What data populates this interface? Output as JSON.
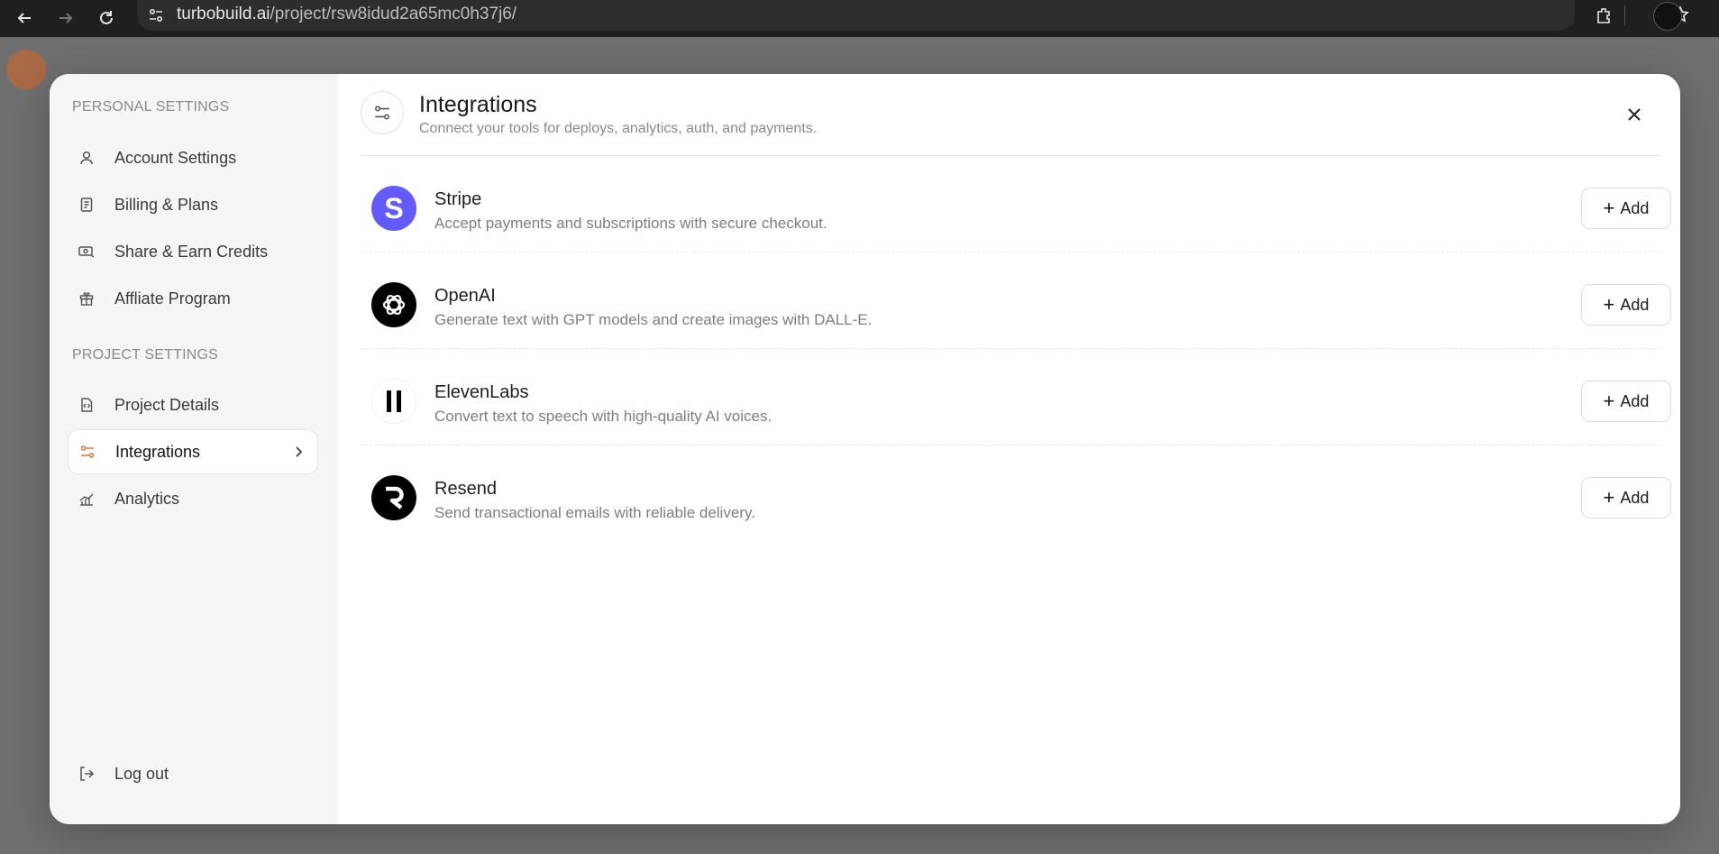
{
  "browser": {
    "url_host": "turbobuild.ai",
    "url_path": "/project/rsw8idud2a65mc0h37j6/",
    "icons": [
      "back-icon",
      "forward-icon",
      "reload-icon",
      "site-info-icon",
      "star-icon",
      "extensions-icon",
      "profile-avatar"
    ]
  },
  "sidebar": {
    "personal_title": "PERSONAL SETTINGS",
    "personal_items": [
      {
        "label": "Account Settings",
        "icon": "user-icon"
      },
      {
        "label": "Billing & Plans",
        "icon": "receipt-icon"
      },
      {
        "label": "Share & Earn Credits",
        "icon": "share-credits-icon"
      },
      {
        "label": "Affliate Program",
        "icon": "gift-icon"
      }
    ],
    "project_title": "PROJECT SETTINGS",
    "project_items": [
      {
        "label": "Project Details",
        "icon": "file-code-icon"
      },
      {
        "label": "Integrations",
        "icon": "sliders-icon",
        "active": true
      },
      {
        "label": "Analytics",
        "icon": "chart-icon"
      }
    ],
    "logout_label": "Log out"
  },
  "header": {
    "title": "Integrations",
    "subtitle": "Connect your tools for deploys, analytics, auth, and payments."
  },
  "integrations": [
    {
      "name": "Stripe",
      "description": "Accept payments and subscriptions with secure checkout.",
      "button": "Add",
      "color": "#635bff"
    },
    {
      "name": "OpenAI",
      "description": "Generate text with GPT models and create images with DALL-E.",
      "button": "Add",
      "color": "#000000"
    },
    {
      "name": "ElevenLabs",
      "description": "Convert text to speech with high-quality AI voices.",
      "button": "Add",
      "color": "#000000"
    },
    {
      "name": "Resend",
      "description": "Send transactional emails with reliable delivery.",
      "button": "Add",
      "color": "#000000"
    }
  ],
  "colors": {
    "accent": "#d97a3c",
    "stripe": "#635bff",
    "sidebar_bg": "#f5f5f4"
  }
}
